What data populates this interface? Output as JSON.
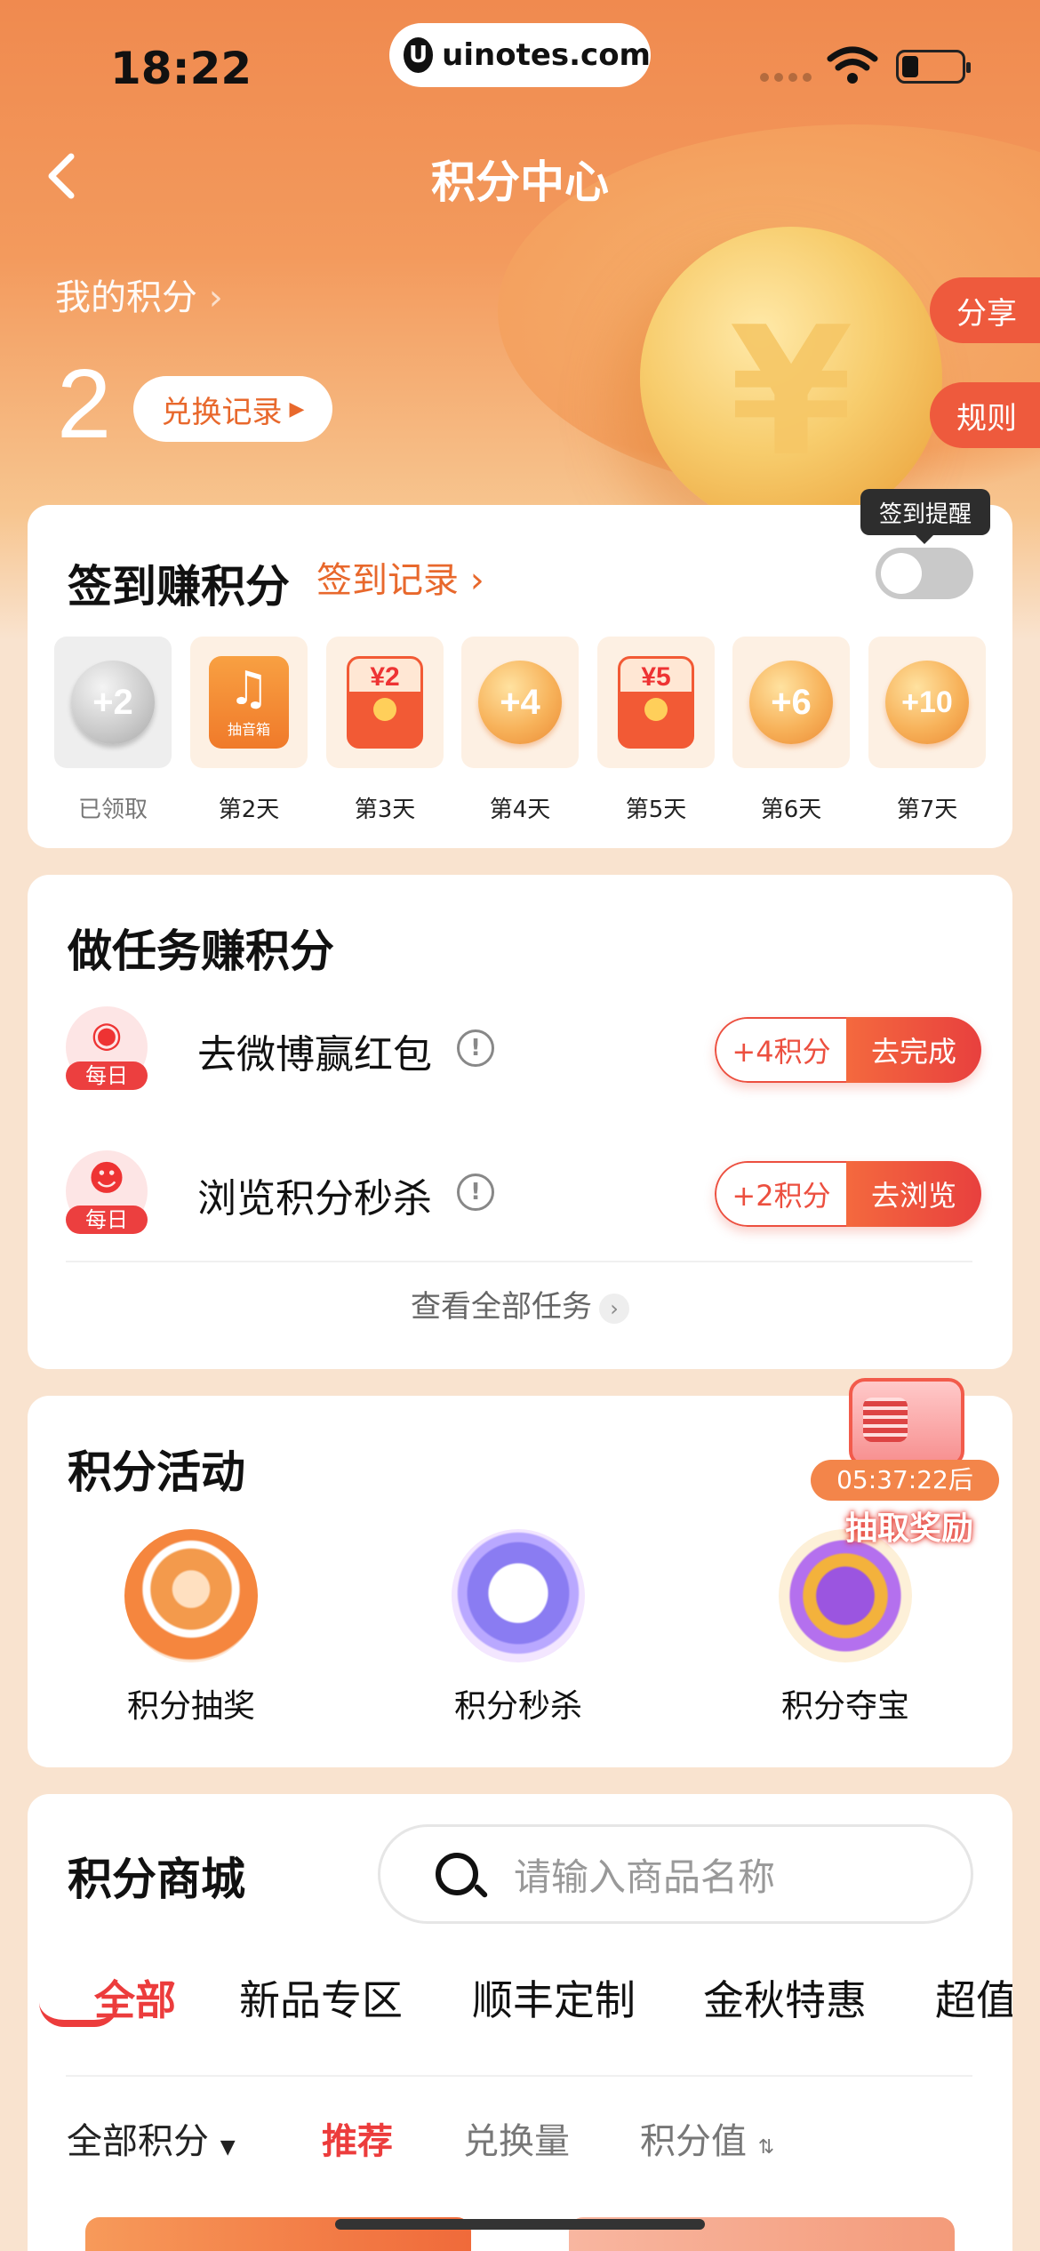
{
  "status": {
    "time": "18:22",
    "url": "uinotes.com"
  },
  "nav": {
    "title": "积分中心"
  },
  "points": {
    "label": "我的积分",
    "value": "2",
    "redeem_label": "兑换记录"
  },
  "side_tabs": {
    "share": "分享",
    "rules": "规则"
  },
  "signin": {
    "title": "签到赚积分",
    "record_link": "签到记录",
    "reminder_tip": "签到提醒",
    "days": [
      {
        "reward": "+2",
        "label": "已领取",
        "kind": "claimed"
      },
      {
        "reward": "抽音箱",
        "label": "第2天",
        "kind": "music"
      },
      {
        "reward": "¥2",
        "label": "第3天",
        "kind": "redpack"
      },
      {
        "reward": "+4",
        "label": "第4天",
        "kind": "coin"
      },
      {
        "reward": "¥5",
        "label": "第5天",
        "kind": "redpack"
      },
      {
        "reward": "+6",
        "label": "第6天",
        "kind": "coin"
      },
      {
        "reward": "+10",
        "label": "第7天",
        "kind": "coin"
      }
    ]
  },
  "tasks": {
    "title": "做任务赚积分",
    "items": [
      {
        "name": "去微博赢红包",
        "badge": "每日",
        "points": "+4积分",
        "action": "去完成"
      },
      {
        "name": "浏览积分秒杀",
        "badge": "每日",
        "points": "+2积分",
        "action": "去浏览"
      }
    ],
    "view_all": "查看全部任务"
  },
  "activities": {
    "title": "积分活动",
    "items": [
      {
        "label": "积分抽奖"
      },
      {
        "label": "积分秒杀"
      },
      {
        "label": "积分夺宝"
      }
    ],
    "promo": {
      "timer": "05:37:22后",
      "text": "抽取奖励"
    }
  },
  "mall": {
    "title": "积分商城",
    "search_placeholder": "请输入商品名称",
    "tabs": [
      "全部",
      "新品专区",
      "顺丰定制",
      "金秋特惠",
      "超值"
    ],
    "sort": {
      "all_points": "全部积分",
      "recommend": "推荐",
      "volume": "兑换量",
      "value": "积分值"
    }
  },
  "colors": {
    "accent": "#ec3c3c",
    "orange": "#e8682c",
    "hero": "#f08a4f"
  }
}
